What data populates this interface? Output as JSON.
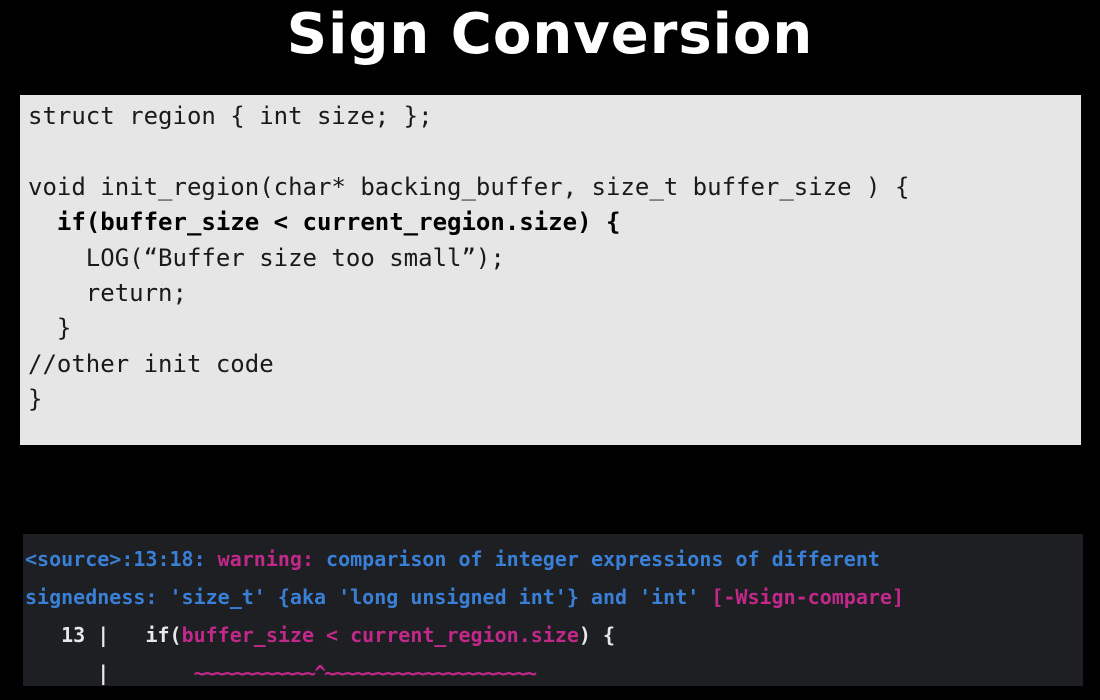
{
  "slide": {
    "title": "Sign Conversion"
  },
  "code": {
    "lines": [
      "struct region { int size; };",
      "",
      "void init_region(char* backing_buffer, size_t buffer_size ) {",
      "  if(buffer_size < current_region.size) {",
      "    LOG(“Buffer size too small”);",
      "    return;",
      "  }",
      "//other init code",
      "}"
    ]
  },
  "compiler": {
    "location": "<source>:13:18:",
    "severity": "warning:",
    "message_part1": "comparison of integer expressions of different",
    "message_part2_a": "signedness: 'size_t' {aka 'long unsigned int'} and 'int'",
    "flag": "[-Wsign-compare]",
    "line_number": "13",
    "gutter_bar": "|",
    "source_prefix": "if(",
    "source_highlight": "buffer_size < current_region.size",
    "source_suffix": ") {",
    "squiggle": "~~~~~~~~~~~~^~~~~~~~~~~~~~~~~~~~~~"
  },
  "colors": {
    "background": "#000000",
    "code_bg": "#e6e6e6",
    "terminal_bg": "#1d1f22",
    "diagnostic_blue": "#3a7fd6",
    "diagnostic_pink": "#c0288a"
  }
}
